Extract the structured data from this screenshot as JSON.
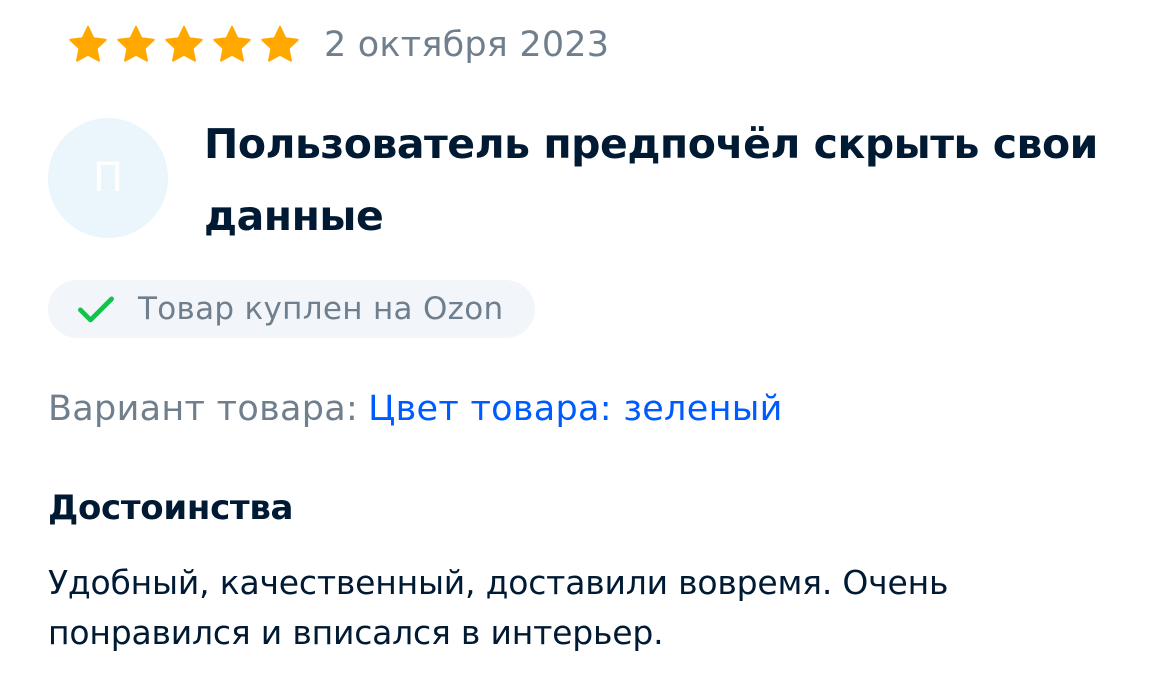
{
  "review": {
    "rating": 5,
    "rating_max": 5,
    "star_color": "#ffa800",
    "date": "2 октября 2023",
    "author": {
      "avatar_letter": "П",
      "avatar_bg": "#eaf5fc",
      "name": "Пользователь предпочёл скрыть свои данные"
    },
    "badge": {
      "icon": "check-icon",
      "icon_color": "#10c44c",
      "text": "Товар куплен на Ozon"
    },
    "variant": {
      "label": "Вариант товара:",
      "value": "Цвет товара: зеленый",
      "value_color": "#005bff"
    },
    "pros": {
      "title": "Достоинства",
      "text": "Удобный, качественный, доставили вовремя. Очень понравился и вписался в интерьер."
    }
  }
}
